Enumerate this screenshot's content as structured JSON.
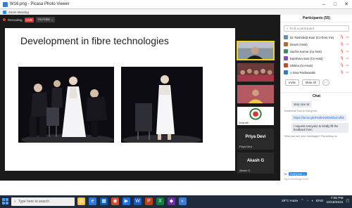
{
  "window": {
    "title": "W16.png - Picasa Photo Viewer",
    "minimize": "–",
    "maximize": "□",
    "close": "✕"
  },
  "zoom": {
    "title": "Zoom Meeting",
    "recording": "Recording",
    "live": "LIVE",
    "youtube": "YouTube ⌄"
  },
  "slide": {
    "title": "Development in fibre technologies"
  },
  "tiles": {
    "tile4_caption": "Sharath",
    "tile5_big": "Priya Devi",
    "tile5_small": "Priya Devi",
    "tile6_big": "Akash G",
    "tile6_small": "Akash G"
  },
  "participants": {
    "header": "Participants (55)",
    "search_placeholder": "Find a participant",
    "list": [
      {
        "name": "Dr. Narinderjit Kaur (Co-host, me)",
        "color": "#6a8caf"
      },
      {
        "name": "Dravin (Host)",
        "color": "#b36b2d"
      },
      {
        "name": "Sachin Kumar (Co-host)",
        "color": "#3e8e5a"
      },
      {
        "name": "Karishma Soni (Co-Host)",
        "color": "#8a4db0"
      },
      {
        "name": "Shikha (Co-Host)",
        "color": "#c34a2c"
      },
      {
        "name": "A Dina Pashawarkii",
        "color": "#2d7bc3"
      }
    ],
    "invite": "Invite",
    "mute_all": "Mute All",
    "more": "···"
  },
  "chat": {
    "header": "Chat",
    "line1": "Very nice sir",
    "from": "Karishma Soni to Everyone:",
    "link": "https://forms.gle/Px3kHtW8eRbaCxfhE",
    "line2": "I request everyone to kindly fill the feedback form.",
    "from2": "Who can see your messages? Recording on",
    "to_label": "To:",
    "to_value": "Everyone ⌄",
    "input_placeholder": "Type message here..."
  },
  "taskbar": {
    "search_text": "Type here to search",
    "weather": "29°C Haze",
    "lang": "ENG",
    "time": "7:06 PM",
    "date": "10/18/2022"
  }
}
